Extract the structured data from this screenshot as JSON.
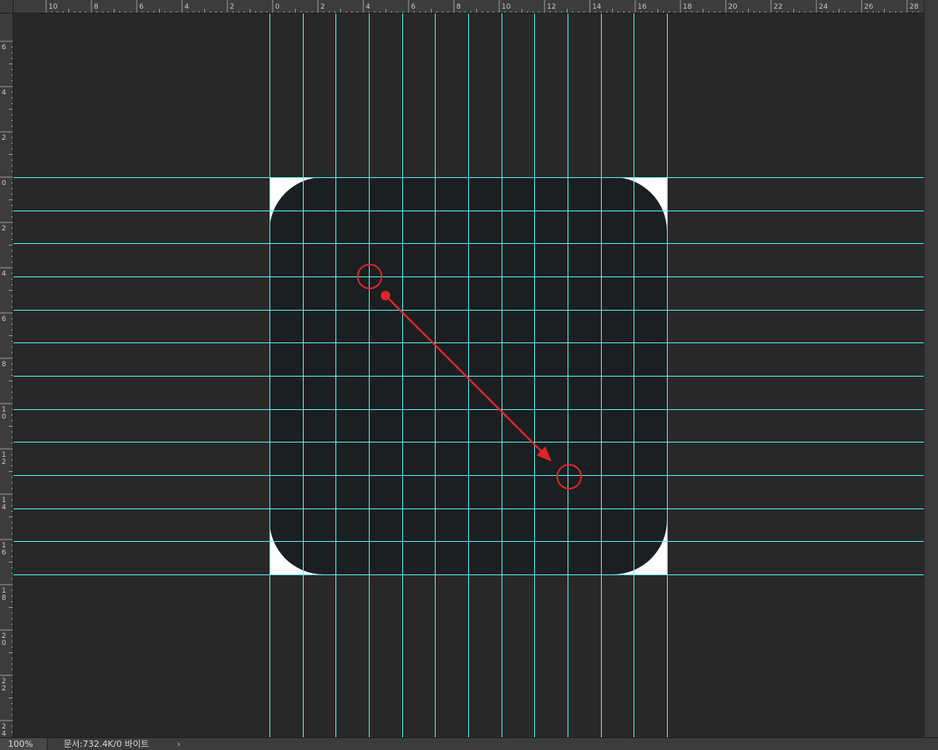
{
  "rulers": {
    "horizontal_labels": [
      "10",
      "8",
      "6",
      "4",
      "2",
      "0",
      "2",
      "4",
      "6",
      "8",
      "10",
      "12",
      "14",
      "16",
      "18",
      "20",
      "22",
      "24",
      "26",
      "28"
    ],
    "vertical_labels": [
      "6",
      "4",
      "2",
      "0",
      "2",
      "4",
      "6",
      "8",
      "10",
      "12",
      "14",
      "16",
      "18",
      "20",
      "22",
      "24"
    ]
  },
  "status_bar": {
    "zoom": "100%",
    "document_info": "문서:732.4K/0 바이트",
    "menu_arrow": "›"
  },
  "colors": {
    "workspace_bg": "#282828",
    "ruler_bg": "#3c3c3c",
    "guide_color": "#5ff0f0",
    "shape_fill": "#1b1f21",
    "artboard_corner": "#ffffff",
    "annotation_red": "#e0242b"
  },
  "canvas": {
    "shape": "rounded-rectangle",
    "guides": {
      "vertical_count": 13,
      "horizontal_count": 13
    },
    "annotation": "red-arrow-between-two-circles"
  }
}
